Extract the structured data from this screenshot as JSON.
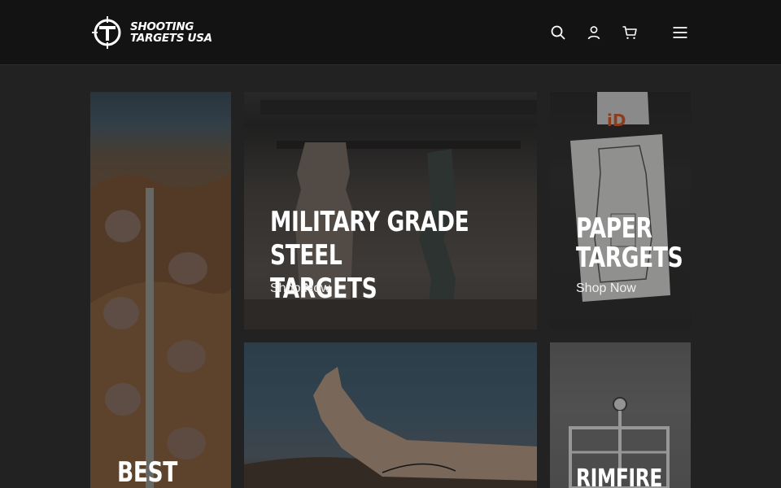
{
  "brand": {
    "line1": "SHOOTING",
    "line2": "TARGETS USA"
  },
  "nav": {
    "icons": [
      "search-icon",
      "account-icon",
      "cart-icon",
      "menu-icon"
    ]
  },
  "tiles": {
    "steel": {
      "title_line1": "MILITARY GRADE STEEL",
      "title_line2": "TARGETS",
      "link": "Shop Now"
    },
    "paper": {
      "title_line1": "PAPER",
      "title_line2": "TARGETS",
      "link": "Shop Now"
    },
    "best": {
      "title_line1": "BEST"
    },
    "rimfire": {
      "title_line1": "RIMFIRE"
    }
  },
  "colors": {
    "header_bg": "#131313",
    "page_bg": "#222222",
    "text": "#ffffff"
  }
}
